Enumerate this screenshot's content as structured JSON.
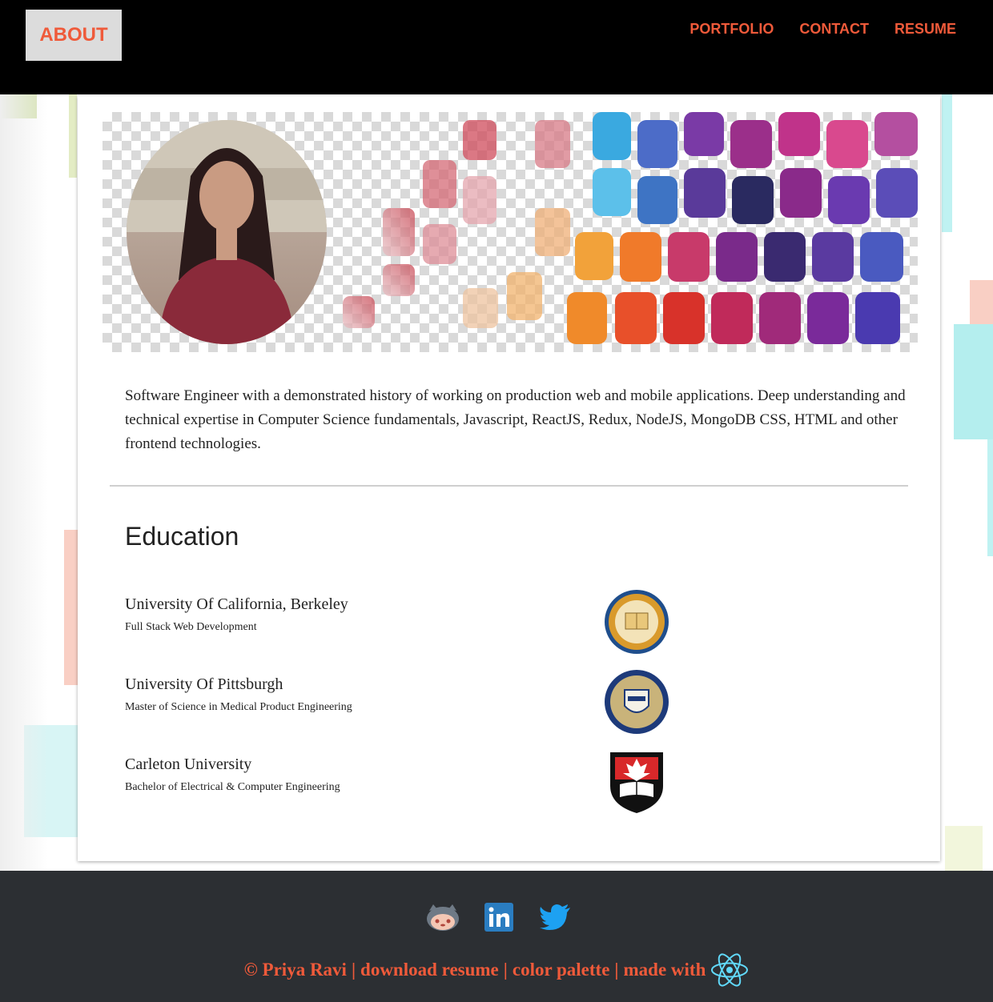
{
  "nav": {
    "about_label": "ABOUT",
    "links": [
      {
        "label": "PORTFOLIO"
      },
      {
        "label": "CONTACT"
      },
      {
        "label": "RESUME"
      }
    ]
  },
  "profile": {
    "bio": "Software Engineer with a demonstrated history of working on production web and mobile applications. Deep understanding and technical expertise in Computer Science fundamentals, Javascript, ReactJS, Redux, NodeJS, MongoDB CSS, HTML and other frontend technologies."
  },
  "education": {
    "title": "Education",
    "items": [
      {
        "school": "University Of California, Berkeley",
        "degree": "Full Stack Web Development",
        "logo": "uc-berkeley-seal-icon"
      },
      {
        "school": "University Of Pittsburgh",
        "degree": "Master of Science in Medical Product Engineering",
        "logo": "pitt-seal-icon"
      },
      {
        "school": "Carleton University",
        "degree": "Bachelor of Electrical & Computer Engineering",
        "logo": "carleton-shield-icon"
      }
    ]
  },
  "footer": {
    "socials": [
      {
        "icon": "github-icon"
      },
      {
        "icon": "linkedin-icon"
      },
      {
        "icon": "twitter-icon"
      }
    ],
    "copyright": "© Priya Ravi",
    "separator": "|",
    "download_resume": "download resume",
    "color_palette": "color palette",
    "made_with": "made with",
    "made_with_icon": "react-icon"
  },
  "colors": {
    "accent": "#ef5a3a",
    "header_bg": "#000000",
    "footer_bg": "#2c2f33",
    "about_button_bg": "#dcdcdc"
  }
}
